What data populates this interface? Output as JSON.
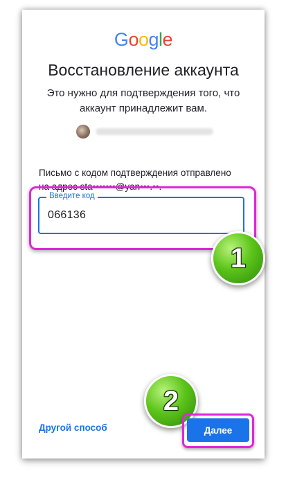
{
  "logo": {
    "letters": [
      "G",
      "o",
      "o",
      "g",
      "l",
      "e"
    ],
    "colors": [
      "#4285F4",
      "#EA4335",
      "#FBBC05",
      "#4285F4",
      "#34A853",
      "#EA4335"
    ]
  },
  "title": "Восстановление аккаунта",
  "subtitle_line1": "Это нужно для подтверждения того, что",
  "subtitle_line2": "аккаунт принадлежит вам.",
  "message_line1": "Письмо с кодом подтверждения отправлено",
  "message_line2": "на адрес sta•••••••@yan•••.••.",
  "code_field": {
    "label": "Введите код",
    "value": "066136"
  },
  "badges": {
    "first": "1",
    "second": "2"
  },
  "actions": {
    "other_way": "Другой способ",
    "next": "Далее"
  },
  "colors": {
    "accent": "#1a73e8",
    "highlight": "#e026d8",
    "badge_green": "#5cc41a"
  }
}
